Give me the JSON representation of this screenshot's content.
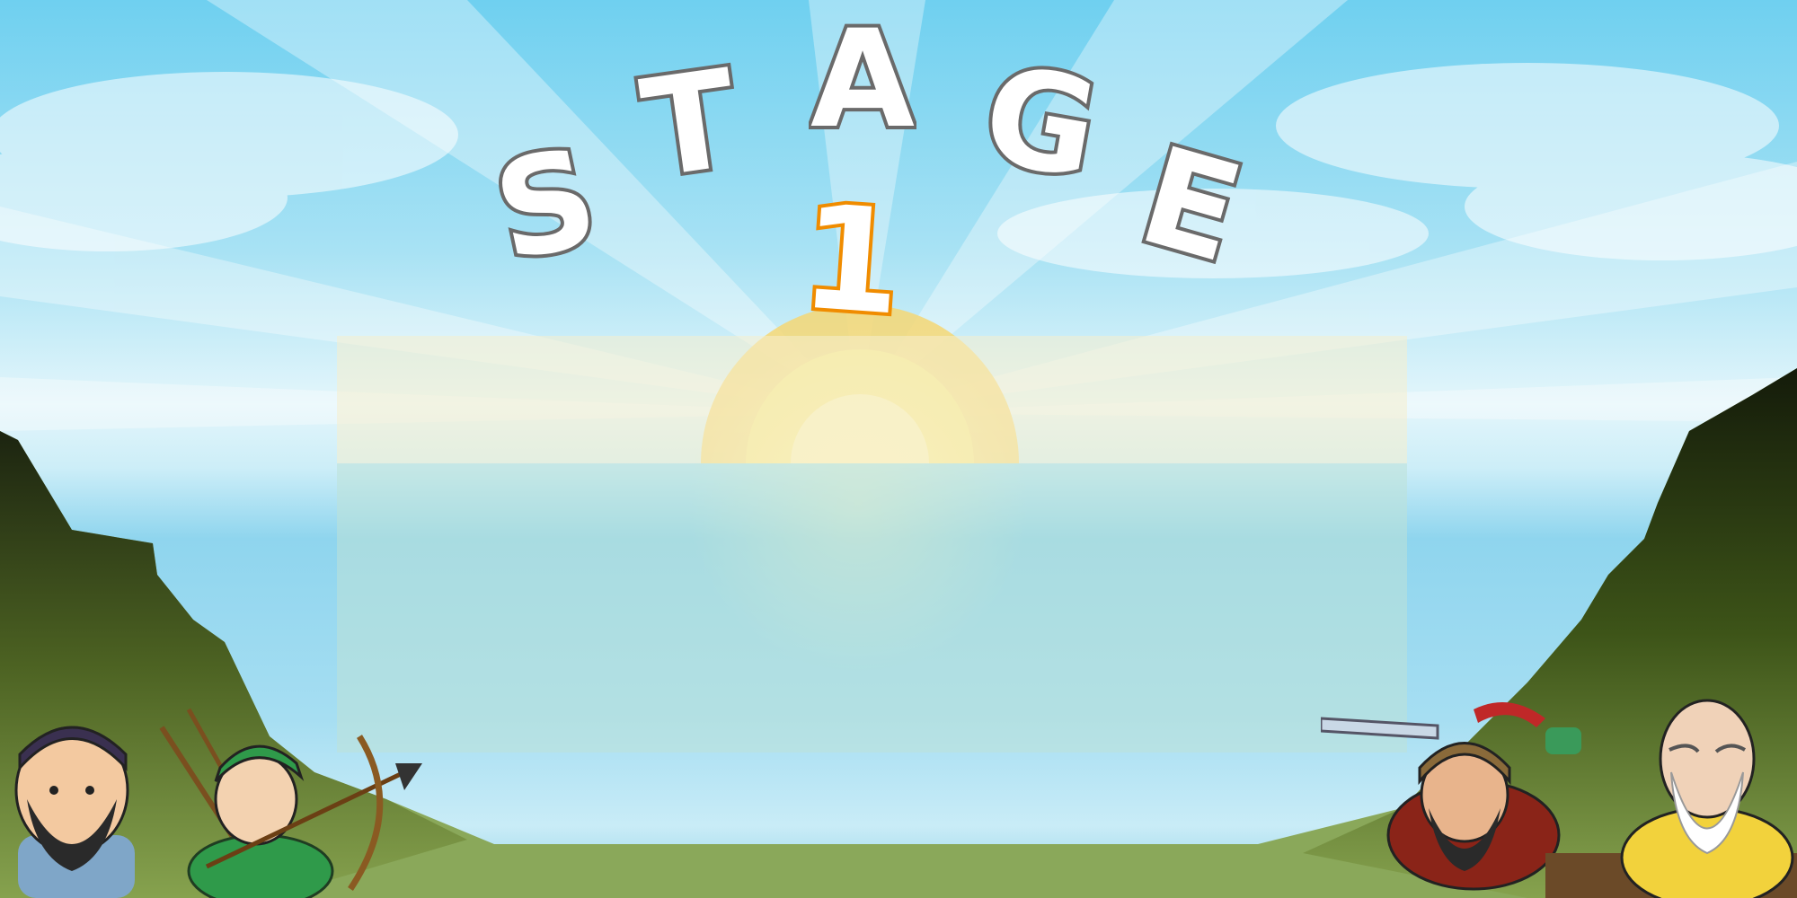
{
  "title": {
    "letters": [
      "S",
      "T",
      "A",
      "G",
      "E"
    ],
    "stage_number": "1"
  },
  "colors": {
    "letter_fill": "#ffffff",
    "letter_outline": "#6a6a6a",
    "stage_number_outline": "#f08c00",
    "cliff_dark": "#1f2a10",
    "grass": "#8aa85a"
  },
  "characters": [
    {
      "name": "bearded-general",
      "side": "left"
    },
    {
      "name": "archer",
      "side": "left"
    },
    {
      "name": "helmeted-warrior",
      "side": "right"
    },
    {
      "name": "old-strategist",
      "side": "right"
    }
  ]
}
